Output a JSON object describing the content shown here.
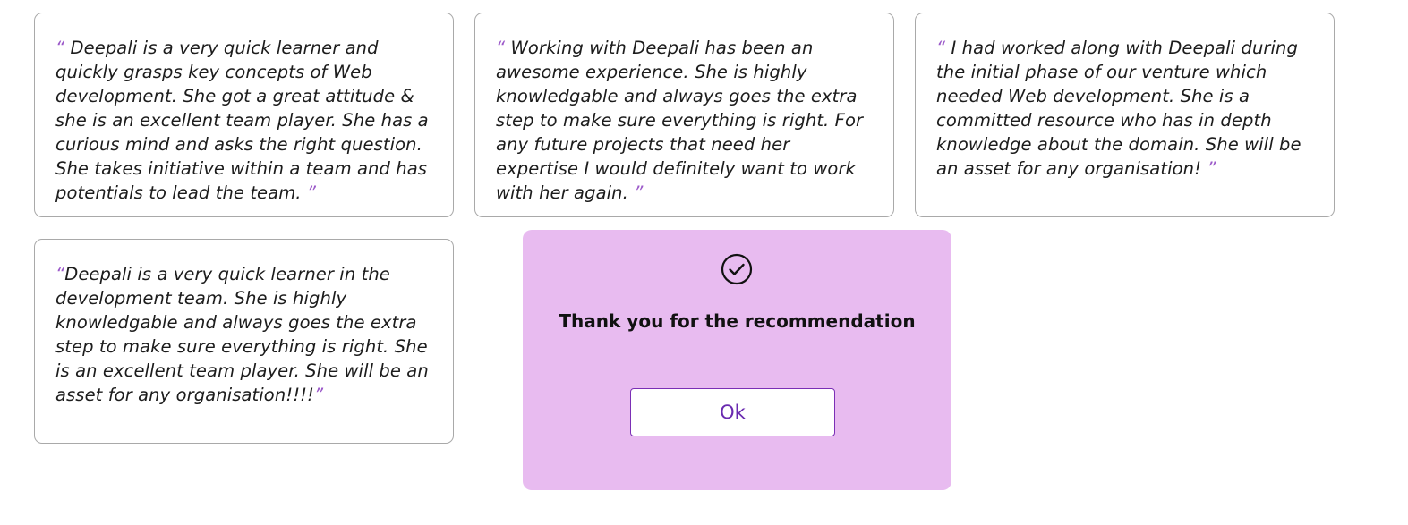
{
  "testimonials": [
    {
      "open_quote": "“ ",
      "text": "Deepali is a very quick learner and quickly grasps key concepts of Web development. She got a great attitude & she is an excellent team player. She has a curious mind and asks the right question. She takes initiative within a team and has potentials to lead the team. ",
      "close_quote": "”"
    },
    {
      "open_quote": "“ ",
      "text": "Working with Deepali has been an awesome experience. She is highly knowledgable and always goes the extra step to make sure everything is right. For any future projects that need her expertise I would definitely want to work with her again. ",
      "close_quote": "”"
    },
    {
      "open_quote": "“ ",
      "text": "I had worked along with Deepali during the initial phase of our venture which needed Web development. She is a committed resource who has in depth knowledge about the domain. She will be an asset for any organisation! ",
      "close_quote": "”"
    },
    {
      "open_quote": "“",
      "text": "Deepali is a very quick learner in the development team. She is highly knowledgable and always goes the extra step to make sure everything is right. She is an excellent team player. She will be an asset for any organisation!!!!",
      "close_quote": "”"
    }
  ],
  "modal": {
    "icon": "check-circle-icon",
    "message": "Thank you for the recommendation",
    "ok_label": "Ok"
  },
  "colors": {
    "quote_accent": "#9b59c9",
    "modal_background": "#e8bbf0",
    "button_text": "#6a2bb0",
    "card_border": "#a9a9a9"
  }
}
